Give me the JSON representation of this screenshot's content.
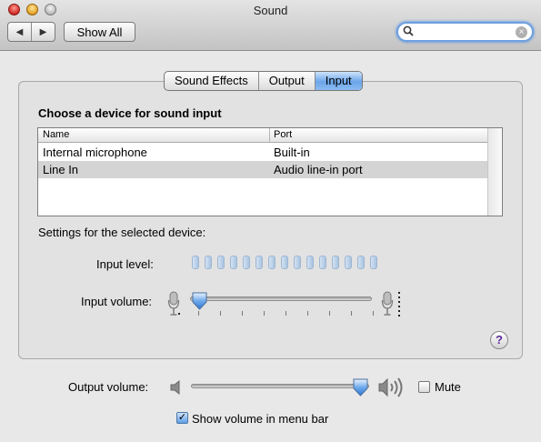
{
  "window": {
    "title": "Sound"
  },
  "toolbar": {
    "back_icon": "back-arrow-icon",
    "forward_icon": "forward-arrow-icon",
    "show_all_label": "Show All",
    "search": {
      "value": "",
      "placeholder": ""
    }
  },
  "tabs": [
    {
      "label": "Sound Effects",
      "active": false
    },
    {
      "label": "Output",
      "active": false
    },
    {
      "label": "Input",
      "active": true
    }
  ],
  "input_panel": {
    "heading": "Choose a device for sound input",
    "table": {
      "columns": [
        "Name",
        "Port"
      ],
      "rows": [
        {
          "name": "Internal microphone",
          "port": "Built-in",
          "selected": false
        },
        {
          "name": "Line In",
          "port": "Audio line-in port",
          "selected": true
        }
      ]
    },
    "settings_heading": "Settings for the selected device:",
    "input_level_label": "Input level:",
    "input_level_segments": 15,
    "input_level_active": 0,
    "input_volume_label": "Input volume:",
    "input_volume_fraction": 0.02,
    "help_label": "?"
  },
  "output": {
    "volume_label": "Output volume:",
    "volume_fraction": 0.95,
    "mute_label": "Mute",
    "mute_checked": false,
    "show_volume_label": "Show volume in menu bar",
    "show_volume_checked": true
  },
  "colors": {
    "accent_blue": "#6aa5ea",
    "selection_gray": "#d4d4d4",
    "help_purple": "#5b2a9a"
  }
}
